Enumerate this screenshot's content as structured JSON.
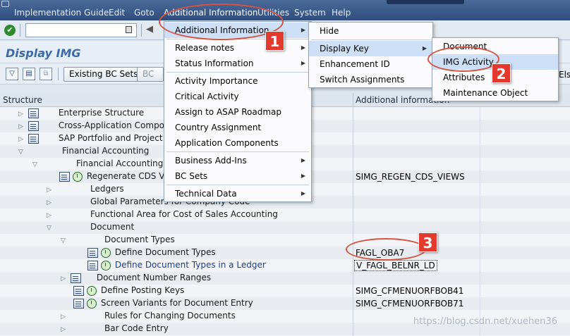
{
  "menubar": {
    "items": [
      "Implementation Guide",
      "Edit",
      "Goto",
      "Additional Information",
      "Utilities",
      "System",
      "Help"
    ]
  },
  "title": "Display IMG",
  "toolbar": {
    "existing_bc_sets": "Existing BC Sets",
    "bc_label": "BC",
    "els": "Els"
  },
  "columns": {
    "structure": "Structure",
    "additional": "Additional information"
  },
  "tree": [
    {
      "label": "Enterprise Structure",
      "info": ""
    },
    {
      "label": "Cross-Application Compone",
      "info": ""
    },
    {
      "label": "SAP Portfolio and Project",
      "info": ""
    },
    {
      "label": "Financial Accounting",
      "info": ""
    },
    {
      "label": "Financial Accounting G",
      "info": ""
    },
    {
      "label": "Regenerate CDS V",
      "info": "SIMG_REGEN_CDS_VIEWS"
    },
    {
      "label": "Ledgers",
      "info": ""
    },
    {
      "label": "Global Parameters for Company Code",
      "info": ""
    },
    {
      "label": "Functional Area for Cost of Sales Accounting",
      "info": ""
    },
    {
      "label": "Document",
      "info": ""
    },
    {
      "label": "Document Types",
      "info": ""
    },
    {
      "label": "Define Document Types",
      "info": "FAGL_OBA7"
    },
    {
      "label": "Define Document Types in a Ledger",
      "info": "V_FAGL_BELNR_LD"
    },
    {
      "label": "Document Number Ranges",
      "info": ""
    },
    {
      "label": "Define Posting Keys",
      "info": "SIMG_CFMENUORFBOB41"
    },
    {
      "label": "Screen Variants for Document Entry",
      "info": "SIMG_CFMENUORFBOB71"
    },
    {
      "label": "Rules for Changing Documents",
      "info": ""
    },
    {
      "label": "Bar Code Entry",
      "info": ""
    }
  ],
  "menu1": [
    "Additional Information",
    "Release notes",
    "Status Information",
    "Activity Importance",
    "Critical Activity",
    "Assign to ASAP Roadmap",
    "Country Assignment",
    "Application Components",
    "Business Add-Ins",
    "BC Sets",
    "Technical Data"
  ],
  "menu2": [
    "Hide",
    "Display Key",
    "Enhancement ID",
    "Switch Assignments"
  ],
  "menu3": [
    "Document",
    "IMG Activity",
    "Attributes",
    "Maintenance Object"
  ],
  "badges": [
    "1",
    "2",
    "3"
  ],
  "watermark": "https://blog.csdn.net/xuehen36",
  "colors": {
    "accent": "#3d6aa8",
    "highlight": "#e23a2e",
    "menubar": "#3b5a8a"
  }
}
